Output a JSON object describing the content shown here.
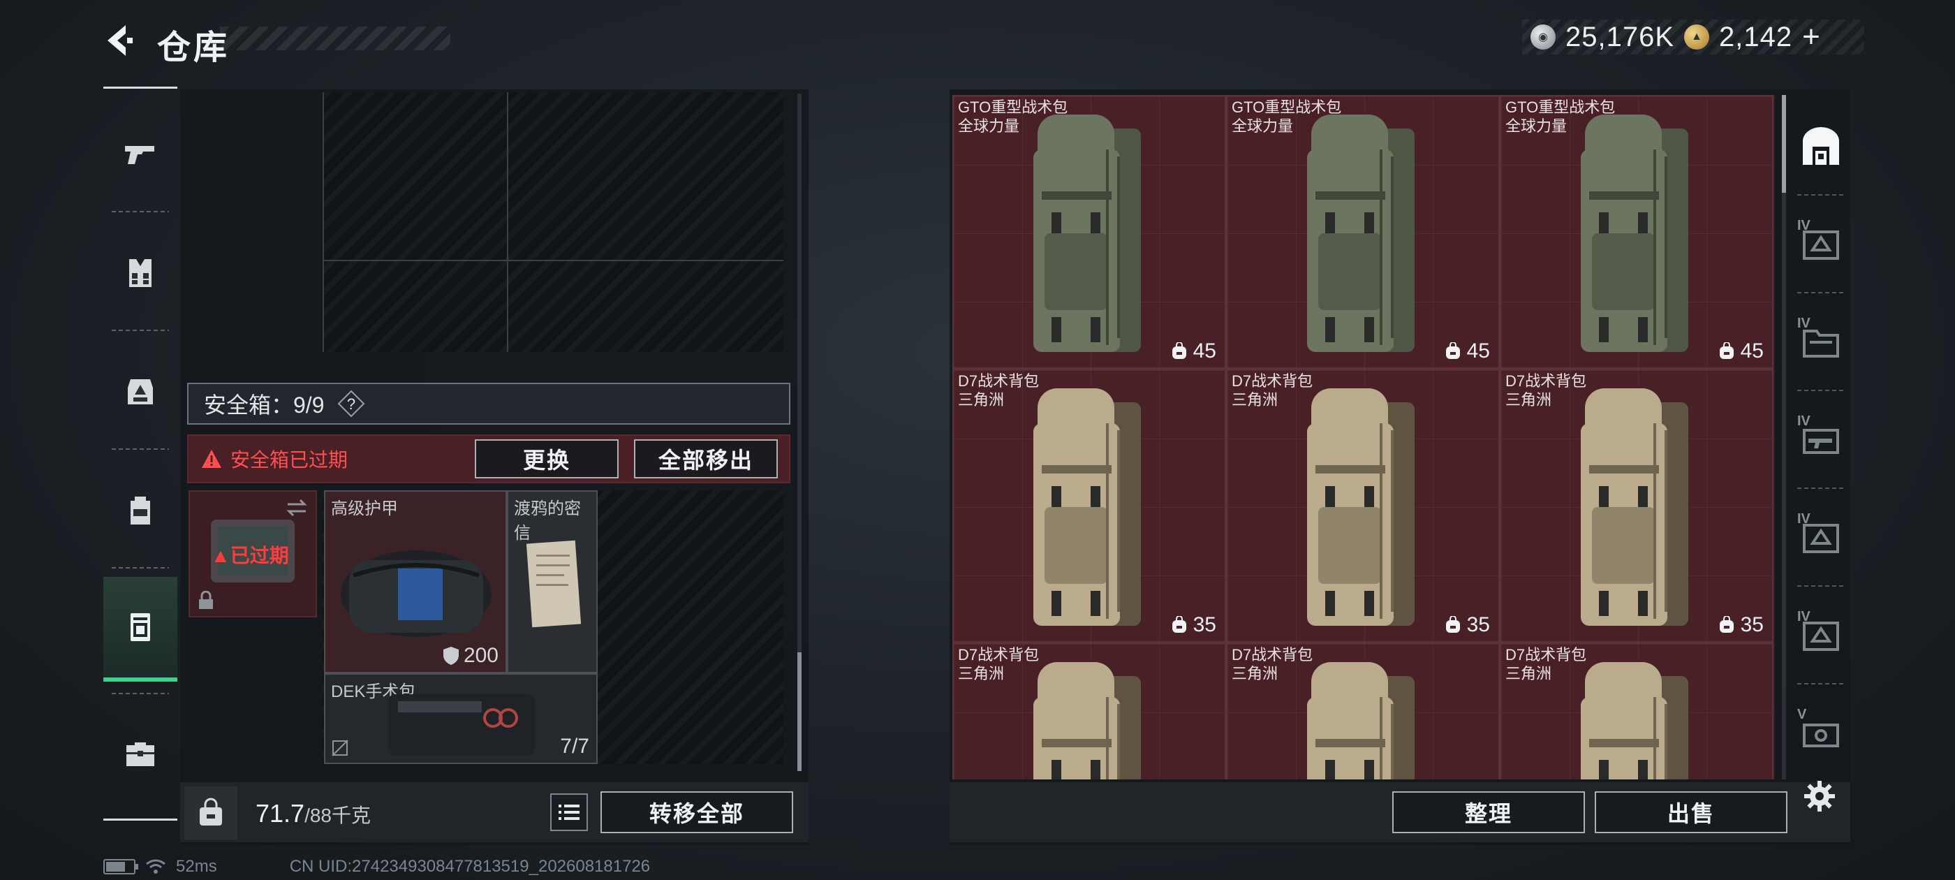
{
  "header": {
    "title": "仓库",
    "currency_silver": "25,176K",
    "currency_gold": "2,142",
    "plus": "+"
  },
  "left_tabs": [
    {
      "icon": "pistol-icon",
      "active": false
    },
    {
      "icon": "vest-icon",
      "active": false
    },
    {
      "icon": "chest-rig-icon",
      "active": false
    },
    {
      "icon": "backpack-icon",
      "active": false
    },
    {
      "icon": "safebox-icon",
      "active": true
    },
    {
      "icon": "briefcase-icon",
      "active": false
    }
  ],
  "safebox": {
    "label": "安全箱：9/9",
    "help": "?",
    "warning": "安全箱已过期",
    "replace_button": "更换",
    "remove_all_button": "全部移出",
    "expired_label": "已过期"
  },
  "items": {
    "armor": {
      "name": "高级护甲",
      "value": "200"
    },
    "letter": {
      "name": "渡鸦的密信"
    },
    "medkit": {
      "name": "DEK手术包",
      "value": "7/7"
    }
  },
  "bottom_left": {
    "weight": "71.7",
    "weight_max": "/88千克",
    "transfer_all_button": "转移全部"
  },
  "stash": [
    {
      "name": "GTO重型战术包",
      "sub": "全球力量",
      "cap": "45",
      "color": "green"
    },
    {
      "name": "GTO重型战术包",
      "sub": "全球力量",
      "cap": "45",
      "color": "green"
    },
    {
      "name": "GTO重型战术包",
      "sub": "全球力量",
      "cap": "45",
      "color": "green"
    },
    {
      "name": "D7战术背包",
      "sub": "三角洲",
      "cap": "35",
      "color": "tan"
    },
    {
      "name": "D7战术背包",
      "sub": "三角洲",
      "cap": "35",
      "color": "tan"
    },
    {
      "name": "D7战术背包",
      "sub": "三角洲",
      "cap": "35",
      "color": "tan"
    },
    {
      "name": "D7战术背包",
      "sub": "三角洲",
      "cap": "",
      "color": "tan"
    },
    {
      "name": "D7战术背包",
      "sub": "三角洲",
      "cap": "",
      "color": "tan"
    },
    {
      "name": "D7战术背包",
      "sub": "三角洲",
      "cap": "",
      "color": "tan"
    }
  ],
  "bottom_right": {
    "sort_button": "整理",
    "sell_button": "出售"
  },
  "right_tabs": [
    {
      "tier": "",
      "icon": "stash-overview-icon",
      "active": true
    },
    {
      "tier": "IV",
      "icon": "stash-expansion-icon"
    },
    {
      "tier": "IV",
      "icon": "folder-stash-icon"
    },
    {
      "tier": "IV",
      "icon": "weapon-stash-icon"
    },
    {
      "tier": "IV",
      "icon": "stash-expansion-icon"
    },
    {
      "tier": "IV",
      "icon": "stash-expansion-icon"
    },
    {
      "tier": "V",
      "icon": "case-stash-icon"
    }
  ],
  "status": {
    "ping": "52ms",
    "uid": "CN UID:2742349308477813519_202608181726",
    "battery_level": 0.7
  },
  "colors": {
    "accent_green": "#3fd28d",
    "warning_red": "#ff4f4f",
    "stash_bg": "#4a2027"
  }
}
